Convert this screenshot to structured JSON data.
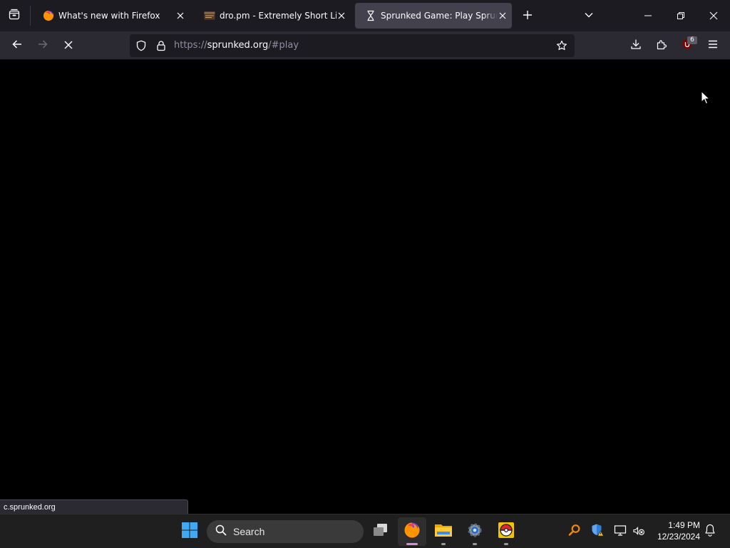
{
  "browser": {
    "tabs": [
      {
        "title": "What's new with Firefox",
        "favicon": "firefox-icon",
        "active": false
      },
      {
        "title": "dro.pm - Extremely Short Links",
        "favicon": "dropm-icon",
        "active": false
      },
      {
        "title": "Sprunked Game: Play Sprunki In",
        "favicon": "hourglass-loading-icon",
        "active": true
      }
    ],
    "url": {
      "scheme": "https://",
      "host": "sprunked.org",
      "path": "/#play"
    },
    "extension_badge": "6",
    "status_link": "c.sprunked.org"
  },
  "taskbar": {
    "search_label": "Search",
    "pinned": [
      "start-icon",
      "task-view-icon",
      "firefox-icon",
      "file-explorer-icon",
      "settings-icon",
      "pokeball-icon"
    ],
    "clock": {
      "time": "1:49 PM",
      "date": "12/23/2024"
    }
  },
  "colors": {
    "tabstrip": "#1c1b22",
    "toolbar": "#2b2a33",
    "active_tab": "#42414d",
    "page": "#000000",
    "taskbar": "#1f1f1f",
    "ublock_red": "#800000"
  }
}
